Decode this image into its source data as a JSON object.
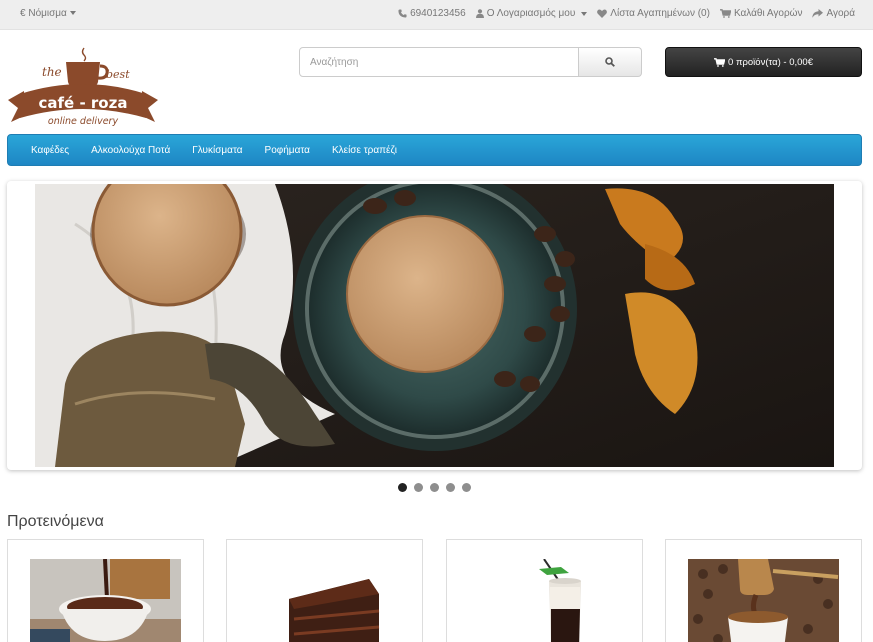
{
  "topbar": {
    "currency_symbol": "€",
    "currency_label": "Νόμισμα",
    "phone": "6940123456",
    "account": "Ο Λογαριασμός μου",
    "wishlist": "Λίστα Αγαπημένων (0)",
    "cart": "Καλάθι Αγορών",
    "checkout": "Αγορά"
  },
  "logo": {
    "line_the": "the",
    "line_best": "best",
    "name": "café - roza",
    "tagline": "online delivery",
    "brand_color": "#8b4a2b"
  },
  "search": {
    "placeholder": "Αναζήτηση"
  },
  "cart_button": {
    "label": "0 προϊόν(τα) - 0,00€"
  },
  "nav": {
    "items": [
      "Καφέδες",
      "Αλκοολούχα Ποτά",
      "Γλυκίσματα",
      "Ροφήματα",
      "Κλείσε τραπέζι"
    ]
  },
  "slideshow": {
    "slide_count": 5,
    "active_index": 0
  },
  "featured": {
    "title": "Προτεινόμενα"
  },
  "colors": {
    "nav": "#2496d0",
    "cart_button": "#333333",
    "topbar": "#eeeeee"
  }
}
